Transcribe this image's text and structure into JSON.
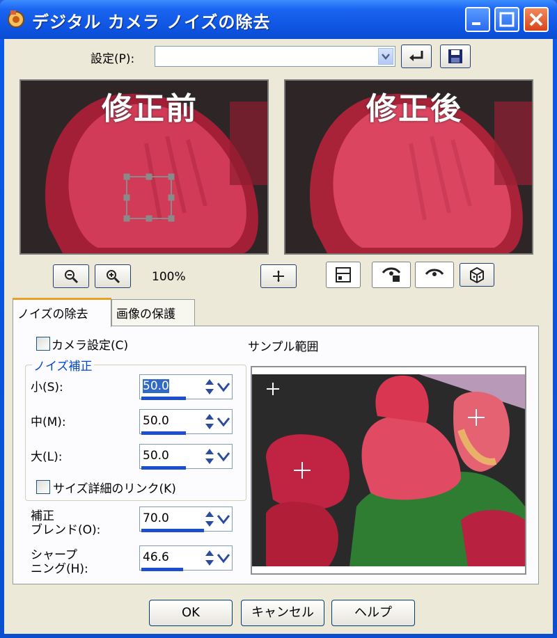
{
  "window": {
    "title": "デジタル カメラ ノイズの除去"
  },
  "preset": {
    "label": "設定(P):",
    "value": ""
  },
  "preview": {
    "before_label": "修正前",
    "after_label": "修正後",
    "zoom": "100%"
  },
  "tabs": [
    {
      "label": "ノイズの除去"
    },
    {
      "label": "画像の保護"
    }
  ],
  "camera_settings": {
    "label": "カメラ設定(C)",
    "checked": false
  },
  "noise_group": {
    "title": "ノイズ補正",
    "small": {
      "label": "小(S):",
      "value": "50.0",
      "percent": 50
    },
    "medium": {
      "label": "中(M):",
      "value": "50.0",
      "percent": 50
    },
    "large": {
      "label": "大(L):",
      "value": "50.0",
      "percent": 50
    },
    "link": {
      "label": "サイズ詳細のリンク(K)",
      "checked": false
    }
  },
  "blend": {
    "label_line1": "補正",
    "label_line2": "ブレンド(O):",
    "value": "70.0",
    "percent": 70
  },
  "sharpening": {
    "label_line1": "シャープ",
    "label_line2": "ニング(H):",
    "value": "46.6",
    "percent": 46.6
  },
  "sample_area": {
    "label": "サンプル範囲"
  },
  "buttons": {
    "ok": "OK",
    "cancel": "キャンセル",
    "help": "ヘルプ"
  },
  "colors": {
    "titlebar": "#0a55e6",
    "face": "#ece9d8",
    "accent": "#e8a127",
    "selection": "#316ac5"
  }
}
